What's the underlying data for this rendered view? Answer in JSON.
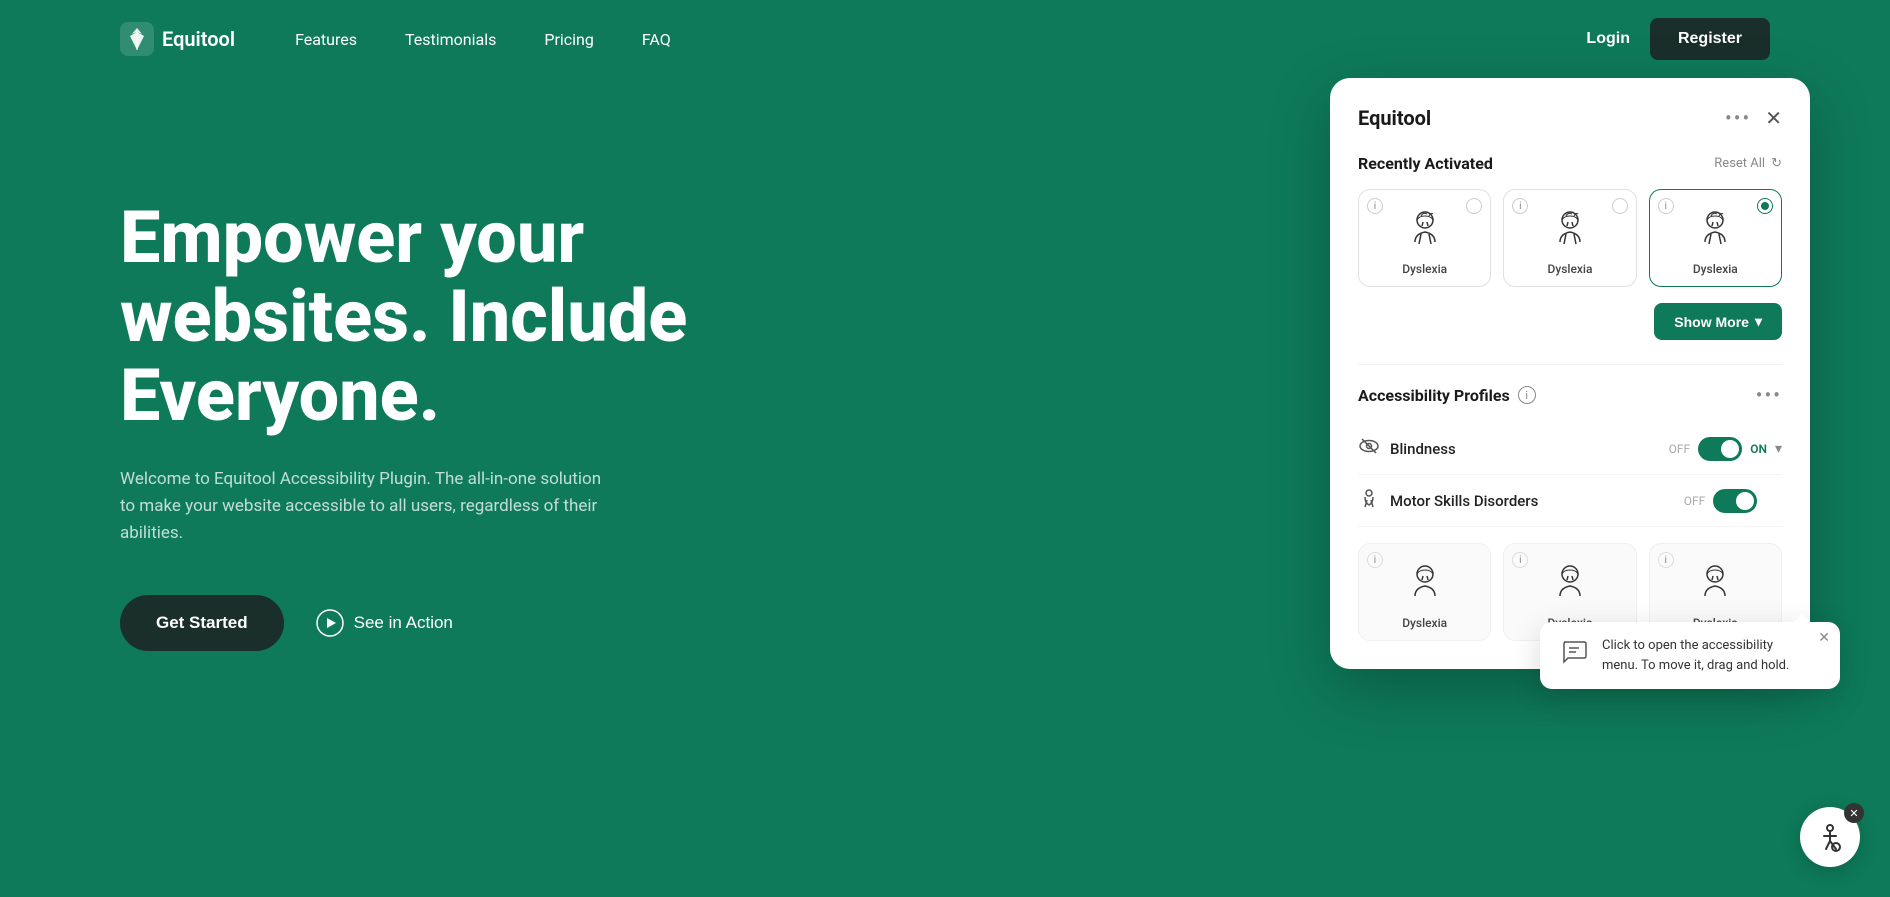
{
  "navbar": {
    "logo_text": "Equitool",
    "nav_links": [
      {
        "label": "Features",
        "id": "features"
      },
      {
        "label": "Testimonials",
        "id": "testimonials"
      },
      {
        "label": "Pricing",
        "id": "pricing"
      },
      {
        "label": "FAQ",
        "id": "faq"
      }
    ],
    "login_label": "Login",
    "register_label": "Register"
  },
  "hero": {
    "title": "Empower your websites. Include Everyone.",
    "subtitle": "Welcome to Equitool Accessibility Plugin. The all-in-one solution to make your website accessible to all users, regardless of their abilities.",
    "get_started_label": "Get Started",
    "see_in_action_label": "See in Action"
  },
  "plugin_panel": {
    "title": "Equitool",
    "recently_activated_label": "Recently Activated",
    "reset_all_label": "Reset All",
    "cards": [
      {
        "label": "Dyslexia",
        "active": false,
        "checked": false
      },
      {
        "label": "Dyslexia",
        "active": false,
        "checked": false
      },
      {
        "label": "Dyslexia",
        "active": true,
        "checked": true
      }
    ],
    "show_more_label": "Show More",
    "accessibility_profiles_label": "Accessibility Profiles",
    "toggles": [
      {
        "label": "Blindness",
        "on": true
      },
      {
        "label": "Motor Skills Disorders",
        "on": true
      }
    ],
    "bottom_cards": [
      {
        "label": "Dyslexia"
      },
      {
        "label": "Dyslexia"
      },
      {
        "label": "Dyslexia"
      }
    ]
  },
  "tooltip": {
    "text": "Click to open the accessibility menu. To move it, drag and hold."
  },
  "icons": {
    "dots": "•••",
    "close": "✕",
    "chevron_down": "▾",
    "play": "▶",
    "info": "i",
    "refresh": "↻",
    "eye": "👁",
    "hand": "✋",
    "chat": "💬",
    "wheelchair": "♿"
  },
  "colors": {
    "primary": "#0e7a5a",
    "dark": "#1a2e2a",
    "white": "#ffffff"
  }
}
